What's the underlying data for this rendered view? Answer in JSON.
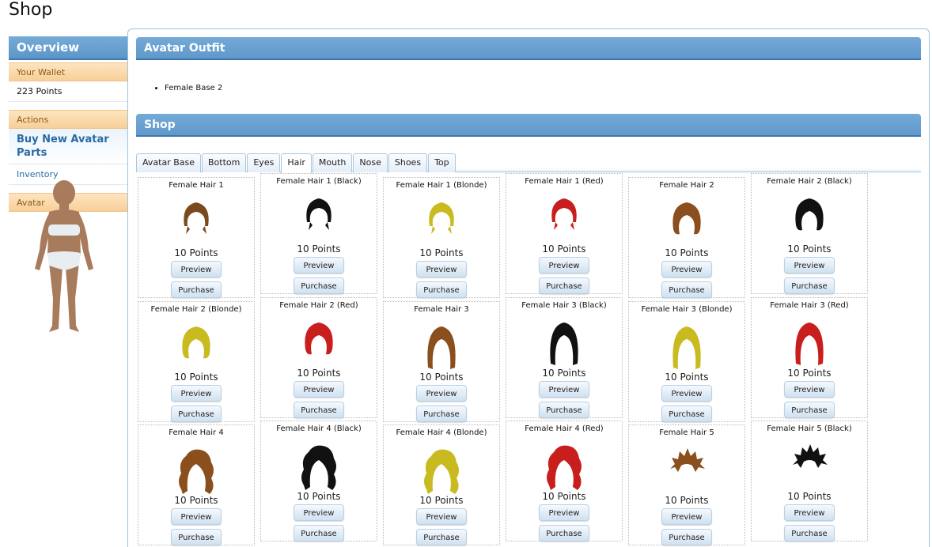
{
  "page": {
    "title": "Shop"
  },
  "sidebar": {
    "header": "Overview",
    "wallet_label": "Your Wallet",
    "wallet_points": "223 Points",
    "actions_label": "Actions",
    "buy_link": "Buy New Avatar Parts",
    "inventory_link": "Inventory",
    "avatar_label": "Avatar"
  },
  "outfit": {
    "header": "Avatar Outfit",
    "items": [
      "Female Base 2"
    ]
  },
  "shop": {
    "header": "Shop",
    "tabs": [
      "Avatar Base",
      "Bottom",
      "Eyes",
      "Hair",
      "Mouth",
      "Nose",
      "Shoes",
      "Top"
    ],
    "active_tab": "Hair",
    "preview_label": "Preview",
    "purchase_label": "Purchase",
    "items": [
      {
        "name": "Female Hair 1",
        "price": "10 Points",
        "color": "#7a4a1e",
        "style": "short"
      },
      {
        "name": "Female Hair 1 (Black)",
        "price": "10 Points",
        "color": "#111111",
        "style": "short"
      },
      {
        "name": "Female Hair 1 (Blonde)",
        "price": "10 Points",
        "color": "#c9bb1f",
        "style": "short"
      },
      {
        "name": "Female Hair 1 (Red)",
        "price": "10 Points",
        "color": "#c81e1e",
        "style": "short"
      },
      {
        "name": "Female Hair 2",
        "price": "10 Points",
        "color": "#8a4f1c",
        "style": "bob"
      },
      {
        "name": "Female Hair 2 (Black)",
        "price": "10 Points",
        "color": "#111111",
        "style": "bob"
      },
      {
        "name": "Female Hair 2 (Blonde)",
        "price": "10 Points",
        "color": "#c9bb1f",
        "style": "bob"
      },
      {
        "name": "Female Hair 2 (Red)",
        "price": "10 Points",
        "color": "#c81e1e",
        "style": "bob"
      },
      {
        "name": "Female Hair 3",
        "price": "10 Points",
        "color": "#8a4f1c",
        "style": "long"
      },
      {
        "name": "Female Hair 3 (Black)",
        "price": "10 Points",
        "color": "#111111",
        "style": "long"
      },
      {
        "name": "Female Hair 3 (Blonde)",
        "price": "10 Points",
        "color": "#c9bb1f",
        "style": "long"
      },
      {
        "name": "Female Hair 3 (Red)",
        "price": "10 Points",
        "color": "#c81e1e",
        "style": "long"
      },
      {
        "name": "Female Hair 4",
        "price": "10 Points",
        "color": "#8a4f1c",
        "style": "curly"
      },
      {
        "name": "Female Hair 4 (Black)",
        "price": "10 Points",
        "color": "#111111",
        "style": "curly"
      },
      {
        "name": "Female Hair 4 (Blonde)",
        "price": "10 Points",
        "color": "#c9bb1f",
        "style": "curly"
      },
      {
        "name": "Female Hair 4 (Red)",
        "price": "10 Points",
        "color": "#c81e1e",
        "style": "curly"
      },
      {
        "name": "Female Hair 5",
        "price": "10 Points",
        "color": "#8a4f1c",
        "style": "spiky"
      },
      {
        "name": "Female Hair 5 (Black)",
        "price": "10 Points",
        "color": "#111111",
        "style": "spiky"
      }
    ]
  },
  "colors": {
    "header_blue": "#5f98cb",
    "section_orange": "#f8cf97",
    "link_blue": "#2a6aa3",
    "skin": "#a87b5c"
  }
}
